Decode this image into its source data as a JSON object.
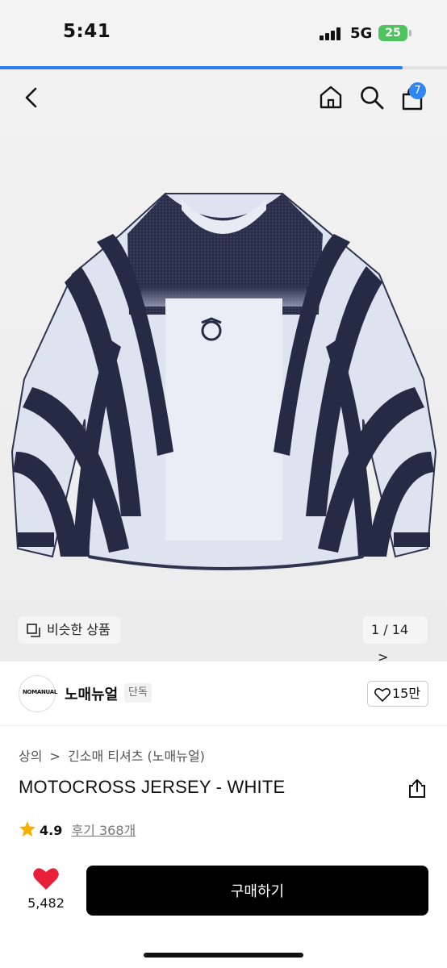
{
  "status_bar": {
    "time": "5:41",
    "network": "5G",
    "battery": "25"
  },
  "gallery": {
    "progress_fraction": 0.9,
    "similar_label": "비슷한 상품",
    "pager": "1 / 14",
    "pager_arrow": ">"
  },
  "header": {
    "cart_count": "7",
    "icons": [
      "back-icon",
      "home-icon",
      "search-icon",
      "cart-icon"
    ]
  },
  "brand": {
    "logo_text": "NOMANUAL",
    "name": "노매뉴얼",
    "badge": "단독",
    "like_count": "15만"
  },
  "product": {
    "breadcrumb_category": "상의",
    "breadcrumb_separator": ">",
    "breadcrumb_sub": "긴소매 티셔츠 (노매뉴얼)",
    "title": "MOTOCROSS JERSEY - WHITE",
    "rating": "4.9",
    "review_label": "후기 368개"
  },
  "bottom_bar": {
    "like_total": "5,482",
    "buy_label": "구매하기"
  },
  "colors": {
    "accent": "#2f86f5",
    "heart": "#e8203a",
    "star": "#f5b100",
    "jersey_navy": "#262b45",
    "jersey_light": "#dfe4f0"
  }
}
